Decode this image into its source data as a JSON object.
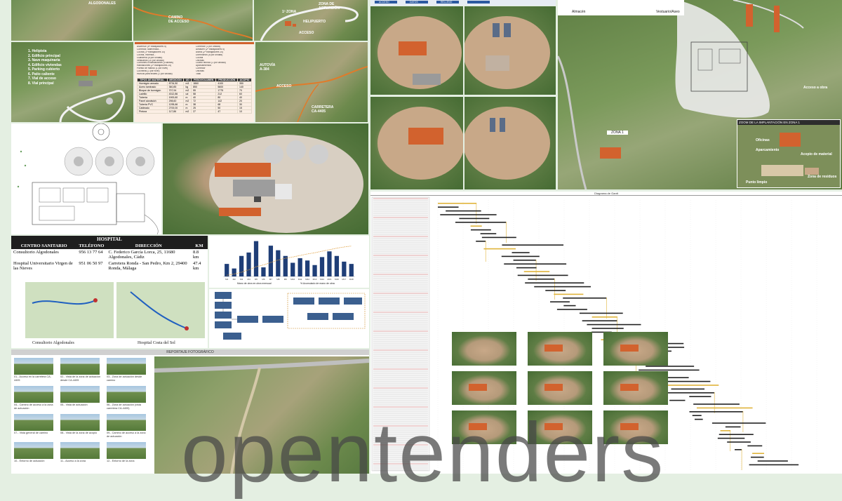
{
  "watermark": "opentenders",
  "top_left": {
    "tile_a_label": "ALGODONALES",
    "tile_b_label": "CAMINO\nDE ACCESO",
    "tile_c_label_zone": "1ª ZONA",
    "tile_c_label_action": "ZONA DE\nACTUACIÓN",
    "tile_c_label_heliport": "HELIPUERTO",
    "tile_c_label_access": "ACCESO"
  },
  "legend": {
    "items": [
      "1. Helipista",
      "2. Edificio principal",
      "3. Nave maquinaria",
      "4. Edificio viviendas",
      "5. Parking cubierto",
      "6. Patio caliente",
      "7. Vial de acceso",
      "8. Vial principal"
    ]
  },
  "program_list": {
    "left_items": [
      "Ascensor (5ª trabajadores 5)",
      "Comedor, taller/edilia...",
      "Cocina (1ª trabajadores 10)",
      "Cocina, vivienda...",
      "Guardería (5 por unidad)",
      "Vestuarios (10 por unidad)",
      "Comunes a edificaciones (4 tareas)",
      "Habitaciones (2ª trabajadores 25)",
      "Puesto de mando (1 por nivel)",
      "Cocheras (1 por nivel)",
      "Huecos para finales (1 por unidad)"
    ],
    "right_items": [
      "Comedor (1 por unidad)",
      "Almacén (2ª trabajadores 5)",
      "Aseos (2ª trabajadores 10)",
      "Dormitorios (5 por unidad)",
      "Cocina",
      "Oficinas",
      "Cuarto técnico (1 por unidad)",
      "Aparcamientos",
      "Comedor",
      "Oficinas",
      "Total"
    ]
  },
  "materials_table": {
    "headers": [
      "TIPOS DE MATERIAL",
      "MEDICIÓN",
      "UD",
      "PESO/VOLUMEN",
      "PRODUCCIÓN",
      "ACOPIO"
    ],
    "rows": [
      [
        "Hormigón armado",
        "8734,50",
        "m3",
        "1860",
        "4100",
        "350"
      ],
      [
        "Acero laminado",
        "360,85",
        "kg",
        "850",
        "5600",
        "140"
      ],
      [
        "Bloque de hormigón",
        "707,94",
        "m2",
        "55",
        "1775",
        "70"
      ],
      [
        "Ladrillo",
        "4312,86",
        "ud",
        "58",
        "212",
        "60"
      ],
      [
        "Tubería",
        "1900,60",
        "m",
        "40",
        "80",
        "40"
      ],
      [
        "Panel sándwich",
        "298,60",
        "m2",
        "72",
        "142",
        "20"
      ],
      [
        "Tubería PVC",
        "1295,66",
        "m",
        "38",
        "68",
        "30"
      ],
      [
        "Cableado",
        "2700,00",
        "m",
        "25",
        "50",
        "15"
      ],
      [
        "Pintura",
        "117,86",
        "m2",
        "27",
        "47",
        "10"
      ]
    ]
  },
  "road_map": {
    "label_highway": "AUTOVÍA\nA-384",
    "label_access": "ACCESO",
    "label_road": "CARRETERA\nCA-4405"
  },
  "top_bar_buttons": [
    "ACCESO",
    "DATOS",
    "RELLENO",
    ""
  ],
  "zone_panel": {
    "label_zone": "ZONA 1",
    "zoom_title": "ZOOM DE LA IMPLANTACIÓN EN ZONA 1",
    "label_access_plant": "Acceso a obra",
    "label_offices": "Oficinas",
    "label_parking": "Aparcamiento",
    "label_storage": "Acopio de material",
    "label_clean": "Punto limpio",
    "label_waste": "Zona de residuos",
    "top_label_a": "Almacén",
    "top_label_b": "Vestuario/Aseo"
  },
  "hospital": {
    "title": "HOSPITAL",
    "headers": [
      "CENTRO SANITARIO",
      "TELÉFONO",
      "DIRECCIÓN",
      "KM"
    ],
    "rows": [
      [
        "Consultorio Algodonales",
        "956 13 77 64",
        "C. Federico García Lorca, 25, 11680 Algodonales, Cádiz",
        "8.8 km"
      ],
      [
        "Hospital Universitario Virgen de las Nieves",
        "951 06 50 97",
        "Carretera Ronda - San Pedro, Km 2, 29400 Ronda, Málaga",
        "47.4 km"
      ]
    ],
    "map_caption_left": "Consultorio Algodonales",
    "map_caption_right": "Hospital Costa del Sol"
  },
  "bar_chart_legend": {
    "bars": "Mano de obra en obra mensual",
    "line": "% Acumulado de mano de obra"
  },
  "chart_data": {
    "type": "bar",
    "categories": [
      "M1",
      "M2",
      "M3",
      "M4",
      "M5",
      "M6",
      "M7",
      "M8",
      "M9",
      "M10",
      "M11",
      "M12",
      "M13",
      "M14",
      "M15",
      "M16",
      "M17",
      "M18"
    ],
    "values": [
      5500,
      3500,
      9000,
      10500,
      15500,
      4000,
      13500,
      11500,
      9000,
      6000,
      8000,
      7000,
      5000,
      8500,
      11000,
      9000,
      6500,
      5500
    ],
    "line_values": [
      4,
      8,
      14,
      22,
      32,
      38,
      46,
      54,
      60,
      64,
      69,
      74,
      78,
      83,
      88,
      93,
      97,
      100
    ],
    "ylim": [
      0,
      16000
    ],
    "y2lim": [
      0,
      120
    ]
  },
  "photo_report": {
    "title": "REPORTAJE FOTOGRÁFICO",
    "captions": [
      "01.- Acceso en la carretera CA-4405",
      "02.- Vista de la zona de actuación desde CA-4405",
      "03.- Zona de actuación desde camino",
      "04.- Camino de acceso a la zona de actuación",
      "05.- Vista de actuación",
      "06.- Zona de actuación (vista carretera CA-4405)",
      "07.- Vista general de camino",
      "08.- Vista de la zona de acopio",
      "09.- Camino de acceso a la zona de actuación",
      "10.- Entorno de actuación",
      "11.- Acceso a la zona",
      "12.- Entorno de la zona"
    ]
  },
  "gantt": {
    "title": "Diagrama de Gantt"
  },
  "colors": {
    "background": "#e4efe2",
    "roof": "#d2622e",
    "gantt_bar": "#e0b43a",
    "chart_bar": "#1f3e77",
    "chart_line": "#e0a040"
  }
}
